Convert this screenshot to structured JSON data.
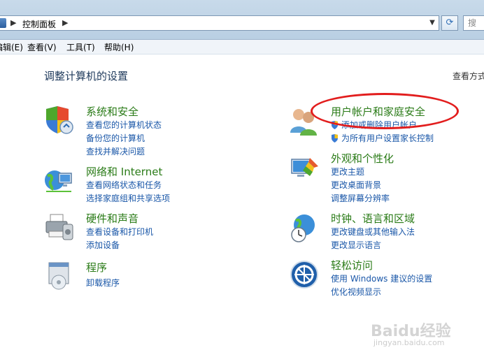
{
  "address_bar": {
    "crumb": "控制面板",
    "search_placeholder": "搜"
  },
  "menu": [
    {
      "label": "编辑(E)"
    },
    {
      "label": "查看(V)"
    },
    {
      "label": "工具(T)"
    },
    {
      "label": "帮助(H)"
    }
  ],
  "heading": "调整计算机的设置",
  "view_by": "查看方式",
  "categories": {
    "security": {
      "title": "系统和安全",
      "links": [
        "查看您的计算机状态",
        "备份您的计算机",
        "查找并解决问题"
      ]
    },
    "network": {
      "title": "网络和 Internet",
      "links": [
        "查看网络状态和任务",
        "选择家庭组和共享选项"
      ]
    },
    "hardware": {
      "title": "硬件和声音",
      "links": [
        "查看设备和打印机",
        "添加设备"
      ]
    },
    "programs": {
      "title": "程序",
      "links": [
        "卸载程序"
      ]
    },
    "users": {
      "title": "用户帐户和家庭安全",
      "links": [
        "添加或删除用户帐户",
        "为所有用户设置家长控制"
      ]
    },
    "appearance": {
      "title": "外观和个性化",
      "links": [
        "更改主题",
        "更改桌面背景",
        "调整屏幕分辨率"
      ]
    },
    "clock": {
      "title": "时钟、语言和区域",
      "links": [
        "更改键盘或其他输入法",
        "更改显示语言"
      ]
    },
    "ease": {
      "title": "轻松访问",
      "links": [
        "使用 Windows 建议的设置",
        "优化视频显示"
      ]
    }
  },
  "watermark": {
    "brand": "Baidu经验",
    "url": "jingyan.baidu.com"
  },
  "colors": {
    "category_title": "#2a7b17",
    "link": "#1a57a8",
    "annotation": "#e21d1d"
  }
}
